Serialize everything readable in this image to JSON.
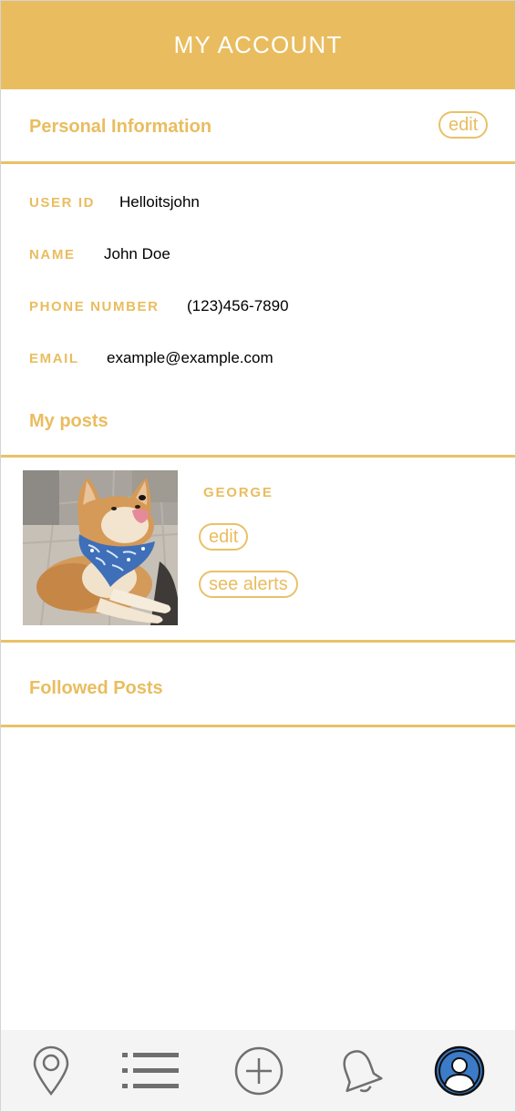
{
  "header": {
    "title": "MY ACCOUNT"
  },
  "personal_info": {
    "title": "Personal Information",
    "edit_label": "edit",
    "fields": [
      {
        "label": "USER ID",
        "value": "Helloitsjohn"
      },
      {
        "label": "NAME",
        "value": "John Doe"
      },
      {
        "label": "PHONE NUMBER",
        "value": "(123)456-7890"
      },
      {
        "label": "EMAIL",
        "value": "example@example.com"
      }
    ]
  },
  "my_posts": {
    "title": "My posts",
    "posts": [
      {
        "name": "GEORGE",
        "photo": "shiba-inu-dog-with-blue-bandana",
        "edit_label": "edit",
        "alerts_label": "see alerts"
      }
    ]
  },
  "followed_posts": {
    "title": "Followed Posts"
  },
  "bottom_nav": {
    "items": [
      {
        "icon": "map-pin-icon"
      },
      {
        "icon": "list-icon"
      },
      {
        "icon": "plus-circle-icon"
      },
      {
        "icon": "bell-icon"
      },
      {
        "icon": "account-icon",
        "active": true
      }
    ]
  },
  "colors": {
    "accent": "#E9BD5F",
    "header_bg": "#E9BD5F",
    "nav_bg": "#f4f4f4",
    "active_icon": "#3B7BC8",
    "icon_gray": "#6f6f6f"
  }
}
